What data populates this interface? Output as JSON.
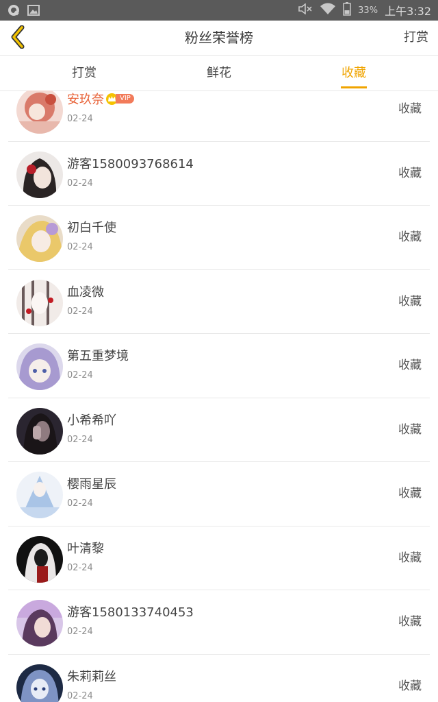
{
  "status_bar": {
    "battery": "33%",
    "time": "上午3:32",
    "icons": [
      "app-icon",
      "image-icon",
      "mute-icon",
      "wifi-icon",
      "battery-icon"
    ]
  },
  "header": {
    "title": "粉丝荣誉榜",
    "right_action": "打赏",
    "back_icon": "chevron-left-icon"
  },
  "tabs": [
    {
      "label": "打赏",
      "active": false
    },
    {
      "label": "鲜花",
      "active": false
    },
    {
      "label": "收藏",
      "active": true
    }
  ],
  "colors": {
    "accent": "#f0a400",
    "vip_name": "#e8643a",
    "vip_badge": "#f27b5a"
  },
  "vip_label": "VIP",
  "fans": [
    {
      "name": "安玖奈",
      "date": "02-24",
      "action": "收藏",
      "vip": true
    },
    {
      "name": "游客1580093768614",
      "date": "02-24",
      "action": "收藏"
    },
    {
      "name": "初白千使",
      "date": "02-24",
      "action": "收藏"
    },
    {
      "name": "血凌微",
      "date": "02-24",
      "action": "收藏"
    },
    {
      "name": "第五重梦境",
      "date": "02-24",
      "action": "收藏"
    },
    {
      "name": "小希希吖",
      "date": "02-24",
      "action": "收藏"
    },
    {
      "name": "樱雨星辰",
      "date": "02-24",
      "action": "收藏"
    },
    {
      "name": "叶清黎",
      "date": "02-24",
      "action": "收藏"
    },
    {
      "name": "游客1580133740453",
      "date": "02-24",
      "action": "收藏"
    },
    {
      "name": "朱莉莉丝",
      "date": "02-24",
      "action": "收藏"
    }
  ]
}
